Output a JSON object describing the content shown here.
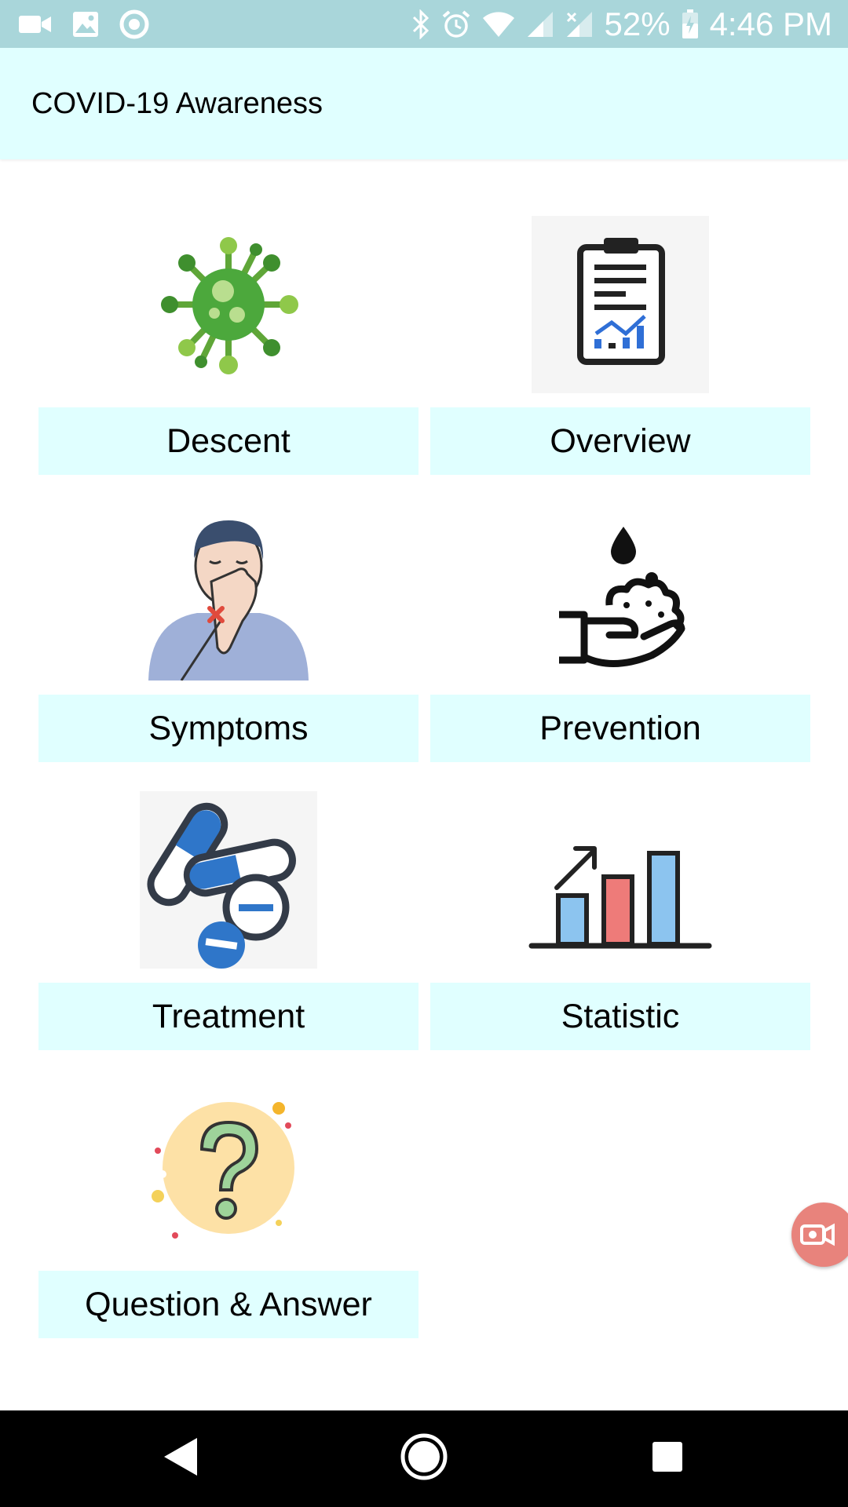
{
  "status_bar": {
    "battery": "52%",
    "time": "4:46 PM",
    "left_icons": [
      "video-camera-icon",
      "image-icon",
      "record-icon"
    ],
    "right_icons": [
      "bluetooth-icon",
      "alarm-icon",
      "wifi-icon",
      "signal-icon",
      "signal-no-data-icon",
      "battery-charging-icon"
    ]
  },
  "app_bar": {
    "title": "COVID-19 Awareness"
  },
  "menu": [
    {
      "label": "Descent",
      "icon": "virus-icon"
    },
    {
      "label": "Overview",
      "icon": "clipboard-chart-icon"
    },
    {
      "label": "Symptoms",
      "icon": "sneezing-person-icon"
    },
    {
      "label": "Prevention",
      "icon": "hand-washing-icon"
    },
    {
      "label": "Treatment",
      "icon": "pills-icon"
    },
    {
      "label": "Statistic",
      "icon": "bar-chart-icon"
    },
    {
      "label": "Question & Answer",
      "icon": "question-mark-icon"
    }
  ],
  "fab": {
    "icon": "screen-record-icon",
    "color": "#e8837c"
  },
  "nav_bar": {
    "buttons": [
      "back-icon",
      "home-icon",
      "recents-icon"
    ]
  },
  "colors": {
    "status_bar": "#a9d6da",
    "app_bar": "#e0ffff",
    "tile_label_bg": "#e0ffff"
  }
}
